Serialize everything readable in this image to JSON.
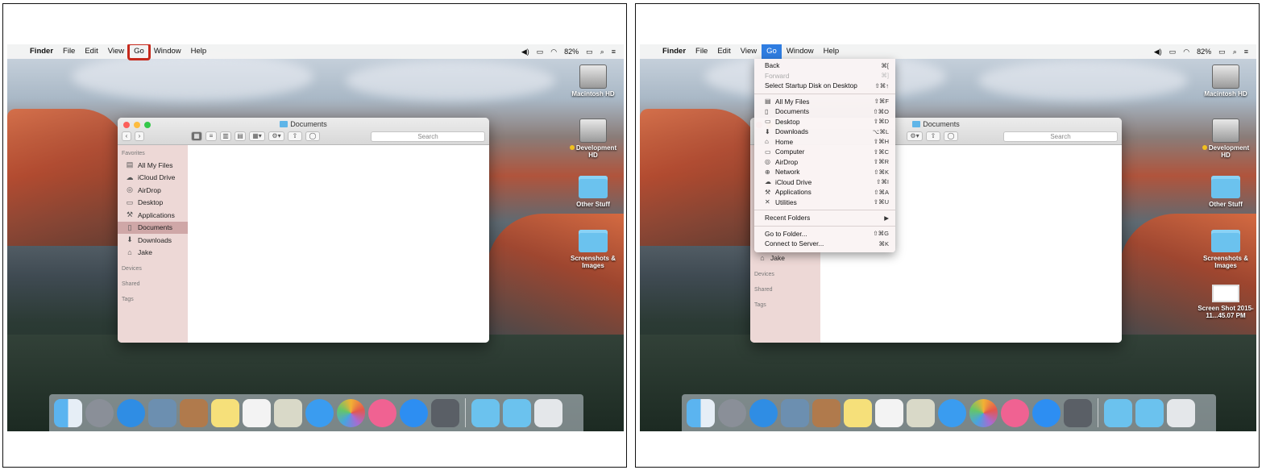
{
  "menubar": {
    "app": "Finder",
    "items": [
      "File",
      "Edit",
      "View",
      "Go",
      "Window",
      "Help"
    ],
    "battery": "82%"
  },
  "finder": {
    "title": "Documents",
    "search_placeholder": "Search",
    "sidebar": {
      "favorites_header": "Favorites",
      "items": [
        {
          "label": "All My Files",
          "icon": "all-files-icon"
        },
        {
          "label": "iCloud Drive",
          "icon": "cloud-icon"
        },
        {
          "label": "AirDrop",
          "icon": "airdrop-icon"
        },
        {
          "label": "Desktop",
          "icon": "desktop-icon"
        },
        {
          "label": "Applications",
          "icon": "applications-icon"
        },
        {
          "label": "Documents",
          "icon": "documents-icon"
        },
        {
          "label": "Downloads",
          "icon": "downloads-icon"
        },
        {
          "label": "Jake",
          "icon": "home-icon"
        }
      ],
      "devices_header": "Devices",
      "shared_header": "Shared",
      "tags_header": "Tags"
    }
  },
  "desktop": {
    "left_icons": [
      "Macintosh HD",
      "Development HD",
      "Other Stuff",
      "Screenshots & Images"
    ],
    "right_icons": [
      "Macintosh HD",
      "Development HD",
      "Other Stuff",
      "Screenshots & Images",
      "Screen Shot 2015-11...45.07 PM"
    ]
  },
  "go_menu": {
    "top": [
      {
        "label": "Back",
        "shortcut": "⌘[",
        "enabled": true
      },
      {
        "label": "Forward",
        "shortcut": "⌘]",
        "enabled": false
      },
      {
        "label": "Select Startup Disk on Desktop",
        "shortcut": "⇧⌘↑",
        "enabled": true
      }
    ],
    "places": [
      {
        "label": "All My Files",
        "shortcut": "⇧⌘F",
        "icon": "all-files-icon"
      },
      {
        "label": "Documents",
        "shortcut": "⇧⌘O",
        "icon": "documents-icon"
      },
      {
        "label": "Desktop",
        "shortcut": "⇧⌘D",
        "icon": "desktop-icon"
      },
      {
        "label": "Downloads",
        "shortcut": "⌥⌘L",
        "icon": "downloads-icon"
      },
      {
        "label": "Home",
        "shortcut": "⇧⌘H",
        "icon": "home-icon"
      },
      {
        "label": "Computer",
        "shortcut": "⇧⌘C",
        "icon": "computer-icon"
      },
      {
        "label": "AirDrop",
        "shortcut": "⇧⌘R",
        "icon": "airdrop-icon"
      },
      {
        "label": "Network",
        "shortcut": "⇧⌘K",
        "icon": "network-icon"
      },
      {
        "label": "iCloud Drive",
        "shortcut": "⇧⌘I",
        "icon": "cloud-icon"
      },
      {
        "label": "Applications",
        "shortcut": "⇧⌘A",
        "icon": "applications-icon"
      },
      {
        "label": "Utilities",
        "shortcut": "⇧⌘U",
        "icon": "utilities-icon"
      }
    ],
    "recent_folders": "Recent Folders",
    "recent_arrow": "▶",
    "bottom": [
      {
        "label": "Go to Folder...",
        "shortcut": "⇧⌘G"
      },
      {
        "label": "Connect to Server...",
        "shortcut": "⌘K"
      }
    ]
  },
  "colors": {
    "highlight_box": "#c62a1d",
    "menu_active": "#2f7de1"
  }
}
